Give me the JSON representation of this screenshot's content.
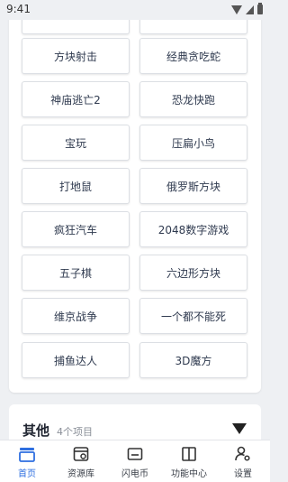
{
  "status_bar": {
    "time": "9:41"
  },
  "games": [
    "方块射击",
    "经典贪吃蛇",
    "神庙逃亡2",
    "恐龙快跑",
    "宝玩",
    "压扁小鸟",
    "打地鼠",
    "俄罗斯方块",
    "疯狂汽车",
    "2048数字游戏",
    "五子棋",
    "六边形方块",
    "维京战争",
    "一个都不能死",
    "捕鱼达人",
    "3D魔方"
  ],
  "section": {
    "title": "其他",
    "count": "4个项目"
  },
  "nav": [
    {
      "label": "首页",
      "icon": "home-icon",
      "active": true
    },
    {
      "label": "资源库",
      "icon": "library-icon",
      "active": false
    },
    {
      "label": "闪电币",
      "icon": "wallet-icon",
      "active": false
    },
    {
      "label": "功能中心",
      "icon": "panel-icon",
      "active": false
    },
    {
      "label": "设置",
      "icon": "user-settings-icon",
      "active": false
    }
  ],
  "colors": {
    "accent": "#2f6fe0",
    "background": "#eef0f3"
  }
}
